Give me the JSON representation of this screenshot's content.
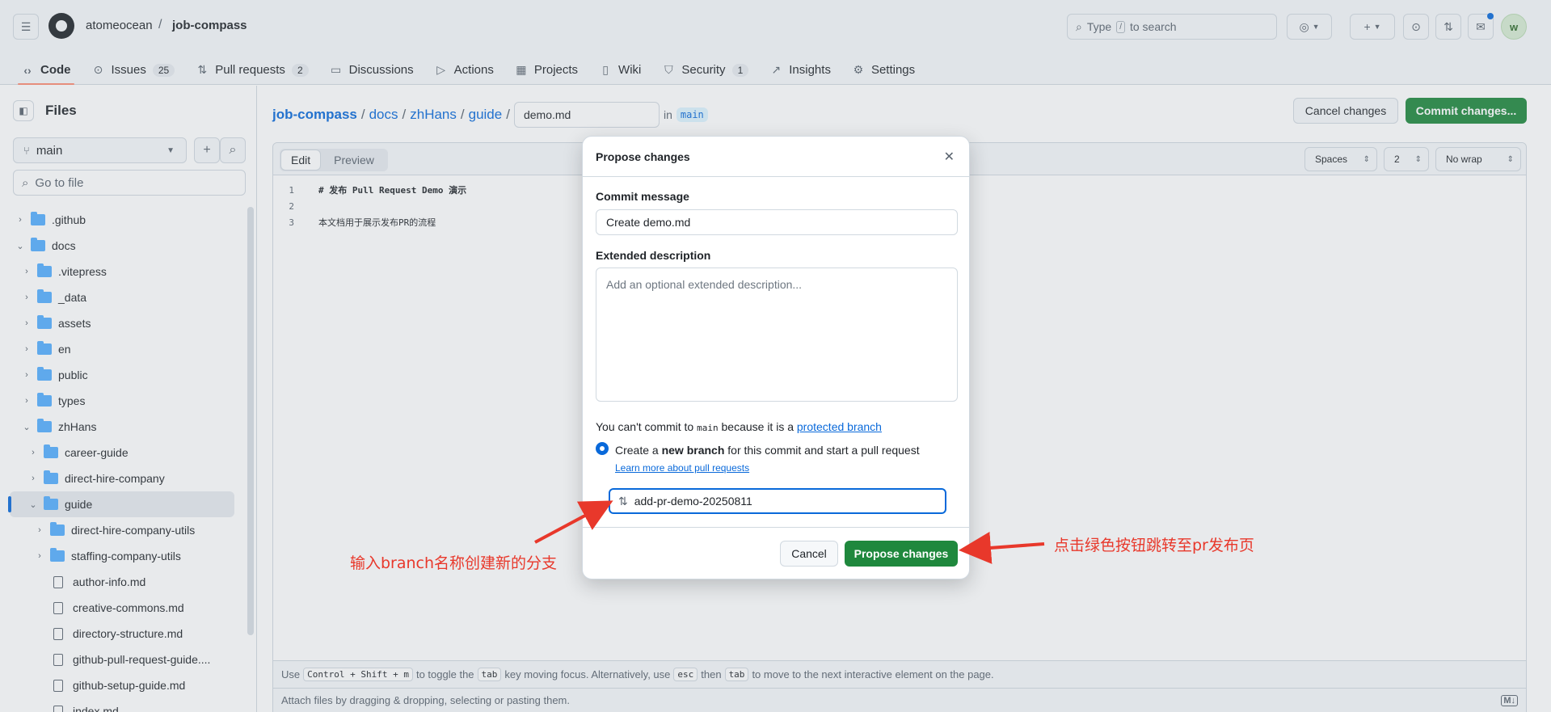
{
  "header": {
    "owner": "atomeocean",
    "repo": "job-compass",
    "search_prefix": "Type",
    "search_key": "/",
    "search_suffix": "to search",
    "avatar_letter": "w"
  },
  "tabs": [
    {
      "label": "Code",
      "icon": "code-icon"
    },
    {
      "label": "Issues",
      "count": "25",
      "icon": "issue-icon"
    },
    {
      "label": "Pull requests",
      "count": "2",
      "icon": "pull-request-icon"
    },
    {
      "label": "Discussions",
      "icon": "discussions-icon"
    },
    {
      "label": "Actions",
      "icon": "play-icon"
    },
    {
      "label": "Projects",
      "icon": "table-icon"
    },
    {
      "label": "Wiki",
      "icon": "book-icon"
    },
    {
      "label": "Security",
      "count": "1",
      "icon": "shield-icon"
    },
    {
      "label": "Insights",
      "icon": "graph-icon"
    },
    {
      "label": "Settings",
      "icon": "gear-icon"
    }
  ],
  "sidebar": {
    "title": "Files",
    "branch": "main",
    "goto_placeholder": "Go to file",
    "tree": [
      {
        "name": ".github",
        "type": "folder",
        "depth": 0,
        "expanded": false
      },
      {
        "name": "docs",
        "type": "folder",
        "depth": 0,
        "expanded": true
      },
      {
        "name": ".vitepress",
        "type": "folder",
        "depth": 1,
        "expanded": false
      },
      {
        "name": "_data",
        "type": "folder",
        "depth": 1,
        "expanded": false
      },
      {
        "name": "assets",
        "type": "folder",
        "depth": 1,
        "expanded": false
      },
      {
        "name": "en",
        "type": "folder",
        "depth": 1,
        "expanded": false
      },
      {
        "name": "public",
        "type": "folder",
        "depth": 1,
        "expanded": false
      },
      {
        "name": "types",
        "type": "folder",
        "depth": 1,
        "expanded": false
      },
      {
        "name": "zhHans",
        "type": "folder",
        "depth": 1,
        "expanded": true
      },
      {
        "name": "career-guide",
        "type": "folder",
        "depth": 2,
        "expanded": false
      },
      {
        "name": "direct-hire-company",
        "type": "folder",
        "depth": 2,
        "expanded": false
      },
      {
        "name": "guide",
        "type": "folder",
        "depth": 2,
        "expanded": true,
        "selected": true
      },
      {
        "name": "direct-hire-company-utils",
        "type": "folder",
        "depth": 3,
        "expanded": false
      },
      {
        "name": "staffing-company-utils",
        "type": "folder",
        "depth": 3,
        "expanded": false
      },
      {
        "name": "author-info.md",
        "type": "file",
        "depth": 3
      },
      {
        "name": "creative-commons.md",
        "type": "file",
        "depth": 3
      },
      {
        "name": "directory-structure.md",
        "type": "file",
        "depth": 3
      },
      {
        "name": "github-pull-request-guide....",
        "type": "file",
        "depth": 3
      },
      {
        "name": "github-setup-guide.md",
        "type": "file",
        "depth": 3
      },
      {
        "name": "index.md",
        "type": "file",
        "depth": 3
      }
    ]
  },
  "path": {
    "segments": [
      "job-compass",
      "docs",
      "zhHans",
      "guide"
    ],
    "filename": "demo.md",
    "in_label": "in",
    "branch": "main"
  },
  "actions": {
    "cancel": "Cancel changes",
    "commit": "Commit changes..."
  },
  "editor": {
    "edit_tab": "Edit",
    "preview_tab": "Preview",
    "indent_mode": "Spaces",
    "indent_size": "2",
    "wrap": "No wrap",
    "lines": [
      {
        "n": "1",
        "text": "# 发布 Pull Request Demo 演示",
        "bold": true
      },
      {
        "n": "2",
        "text": "",
        "bold": false
      },
      {
        "n": "3",
        "text": "本文档用于展示发布PR的流程",
        "bold": false
      }
    ],
    "footer_use": "Use",
    "footer_keys": "Control + Shift + m",
    "footer_toggle": "to toggle the",
    "footer_tab": "tab",
    "footer_mid": "key moving focus. Alternatively, use",
    "footer_esc": "esc",
    "footer_then": "then",
    "footer_tail": "to move to the next interactive element on the page.",
    "attach": "Attach files by dragging & dropping, selecting or pasting them.",
    "md_icon": "M↓"
  },
  "modal": {
    "title": "Propose changes",
    "commit_label": "Commit message",
    "commit_value": "Create demo.md",
    "ext_label": "Extended description",
    "ext_placeholder": "Add an optional extended description...",
    "note_prefix": "You can't commit to",
    "note_branch": "main",
    "note_mid": "because it is a",
    "note_link": "protected branch",
    "radio_pre": "Create a",
    "radio_bold": "new branch",
    "radio_post": "for this commit and start a pull request",
    "learn": "Learn more about pull requests",
    "branch_value": "add-pr-demo-20250811",
    "cancel": "Cancel",
    "propose": "Propose changes"
  },
  "annotations": {
    "left": "输入branch名称创建新的分支",
    "right": "点击绿色按钮跳转至pr发布页"
  },
  "colors": {
    "accent": "#0969da",
    "primary_button": "#1f883d",
    "annotation": "#e8382b"
  }
}
